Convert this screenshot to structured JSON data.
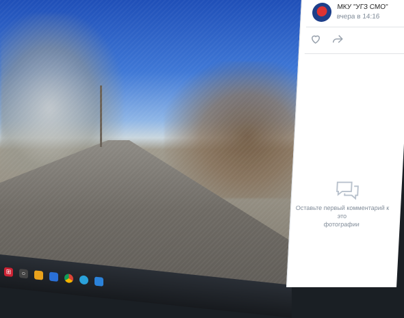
{
  "post": {
    "author": "МКУ \"УГЗ СМО\"",
    "time": "вчера в 14:16"
  },
  "actions": {
    "like_icon": "heart-icon",
    "share_icon": "share-arrow-icon"
  },
  "comments": {
    "empty_icon": "comment-bubbles-icon",
    "empty_line1": "Оставьте первый комментарий к это",
    "empty_line2": "фотографии"
  },
  "taskbar": {
    "icons": [
      "start-icon",
      "search-icon",
      "task-view-icon",
      "browser-icon",
      "chrome-icon",
      "telegram-icon",
      "store-icon"
    ]
  }
}
